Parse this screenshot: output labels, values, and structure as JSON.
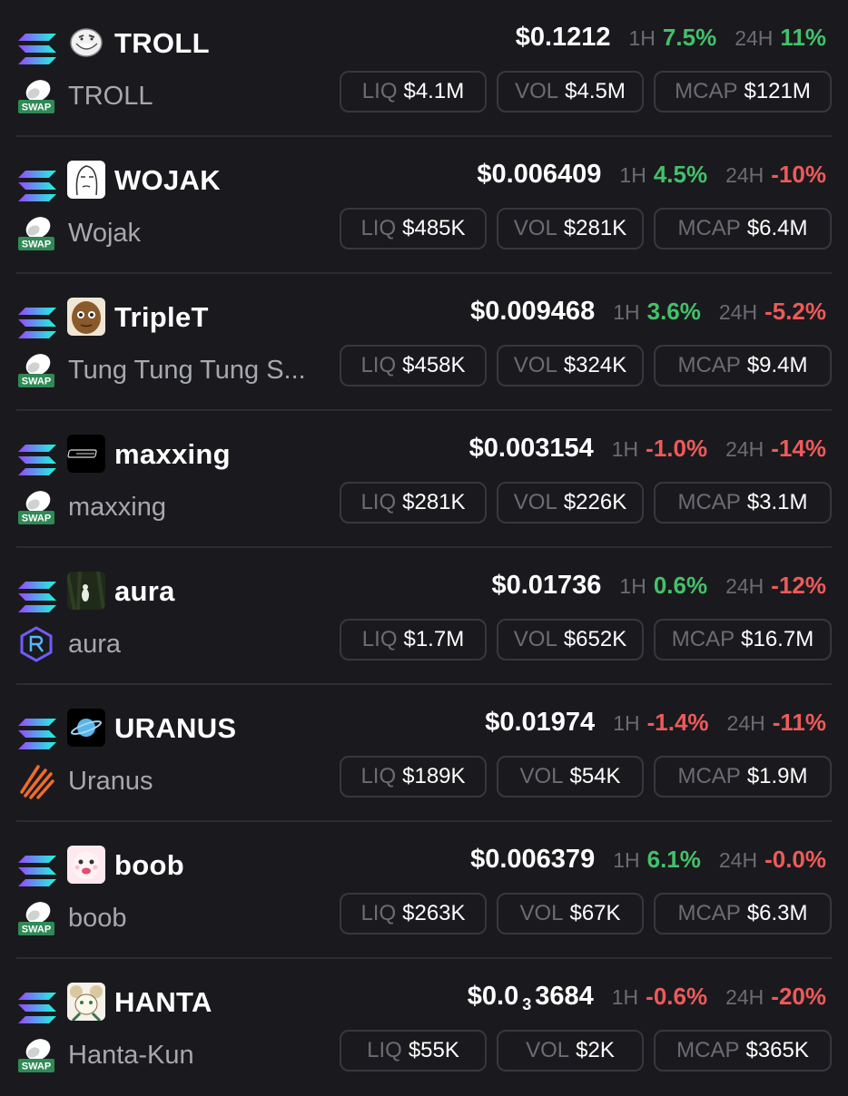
{
  "labels": {
    "liq": "LIQ",
    "vol": "VOL",
    "mcap": "MCAP",
    "h1": "1H",
    "h24": "24H"
  },
  "chain_icon": "solana-icon",
  "colors": {
    "background": "#1a1a1e",
    "positive": "#43c16a",
    "negative": "#ee5a5a",
    "muted": "#6b6c71",
    "border": "#37373d"
  },
  "tokens": [
    {
      "symbol": "TROLL",
      "name": "TROLL",
      "price": "$0.1212",
      "h1": "7.5%",
      "h1_trend": "pos",
      "h24": "11%",
      "h24_trend": "pos",
      "liq": "$4.1M",
      "vol": "$4.5M",
      "mcap": "$121M",
      "avatar": "troll-face-avatar",
      "dex": "swap-icon"
    },
    {
      "symbol": "WOJAK",
      "name": "Wojak",
      "price": "$0.006409",
      "h1": "4.5%",
      "h1_trend": "pos",
      "h24": "-10%",
      "h24_trend": "neg",
      "liq": "$485K",
      "vol": "$281K",
      "mcap": "$6.4M",
      "avatar": "wojak-avatar",
      "dex": "swap-icon"
    },
    {
      "symbol": "TripleT",
      "name": "Tung Tung Tung S...",
      "price": "$0.009468",
      "h1": "3.6%",
      "h1_trend": "pos",
      "h24": "-5.2%",
      "h24_trend": "neg",
      "liq": "$458K",
      "vol": "$324K",
      "mcap": "$9.4M",
      "avatar": "wooden-character-avatar",
      "dex": "swap-icon"
    },
    {
      "symbol": "maxxing",
      "name": "maxxing",
      "price": "$0.003154",
      "h1": "-1.0%",
      "h1_trend": "neg",
      "h24": "-14%",
      "h24_trend": "neg",
      "liq": "$281K",
      "vol": "$226K",
      "mcap": "$3.1M",
      "avatar": "maxxing-logo-avatar",
      "dex": "swap-icon"
    },
    {
      "symbol": "aura",
      "name": "aura",
      "price": "$0.01736",
      "h1": "0.6%",
      "h1_trend": "pos",
      "h24": "-12%",
      "h24_trend": "neg",
      "liq": "$1.7M",
      "vol": "$652K",
      "mcap": "$16.7M",
      "avatar": "forest-avatar",
      "dex": "raydium-icon"
    },
    {
      "symbol": "URANUS",
      "name": "Uranus",
      "price": "$0.01974",
      "h1": "-1.4%",
      "h1_trend": "neg",
      "h24": "-11%",
      "h24_trend": "neg",
      "liq": "$189K",
      "vol": "$54K",
      "mcap": "$1.9M",
      "avatar": "planet-avatar",
      "dex": "meteora-icon"
    },
    {
      "symbol": "boob",
      "name": "boob",
      "price": "$0.006379",
      "h1": "6.1%",
      "h1_trend": "pos",
      "h24": "-0.0%",
      "h24_trend": "neg",
      "liq": "$263K",
      "vol": "$67K",
      "mcap": "$6.3M",
      "avatar": "cartoon-face-avatar",
      "dex": "swap-icon"
    },
    {
      "symbol": "HANTA",
      "name": "Hanta-Kun",
      "price_main": "$0.0",
      "price_sub": "3",
      "price_tail": "3684",
      "h1": "-0.6%",
      "h1_trend": "neg",
      "h24": "-20%",
      "h24_trend": "neg",
      "liq": "$55K",
      "vol": "$2K",
      "mcap": "$365K",
      "avatar": "anime-mouse-avatar",
      "dex": "swap-icon"
    }
  ]
}
